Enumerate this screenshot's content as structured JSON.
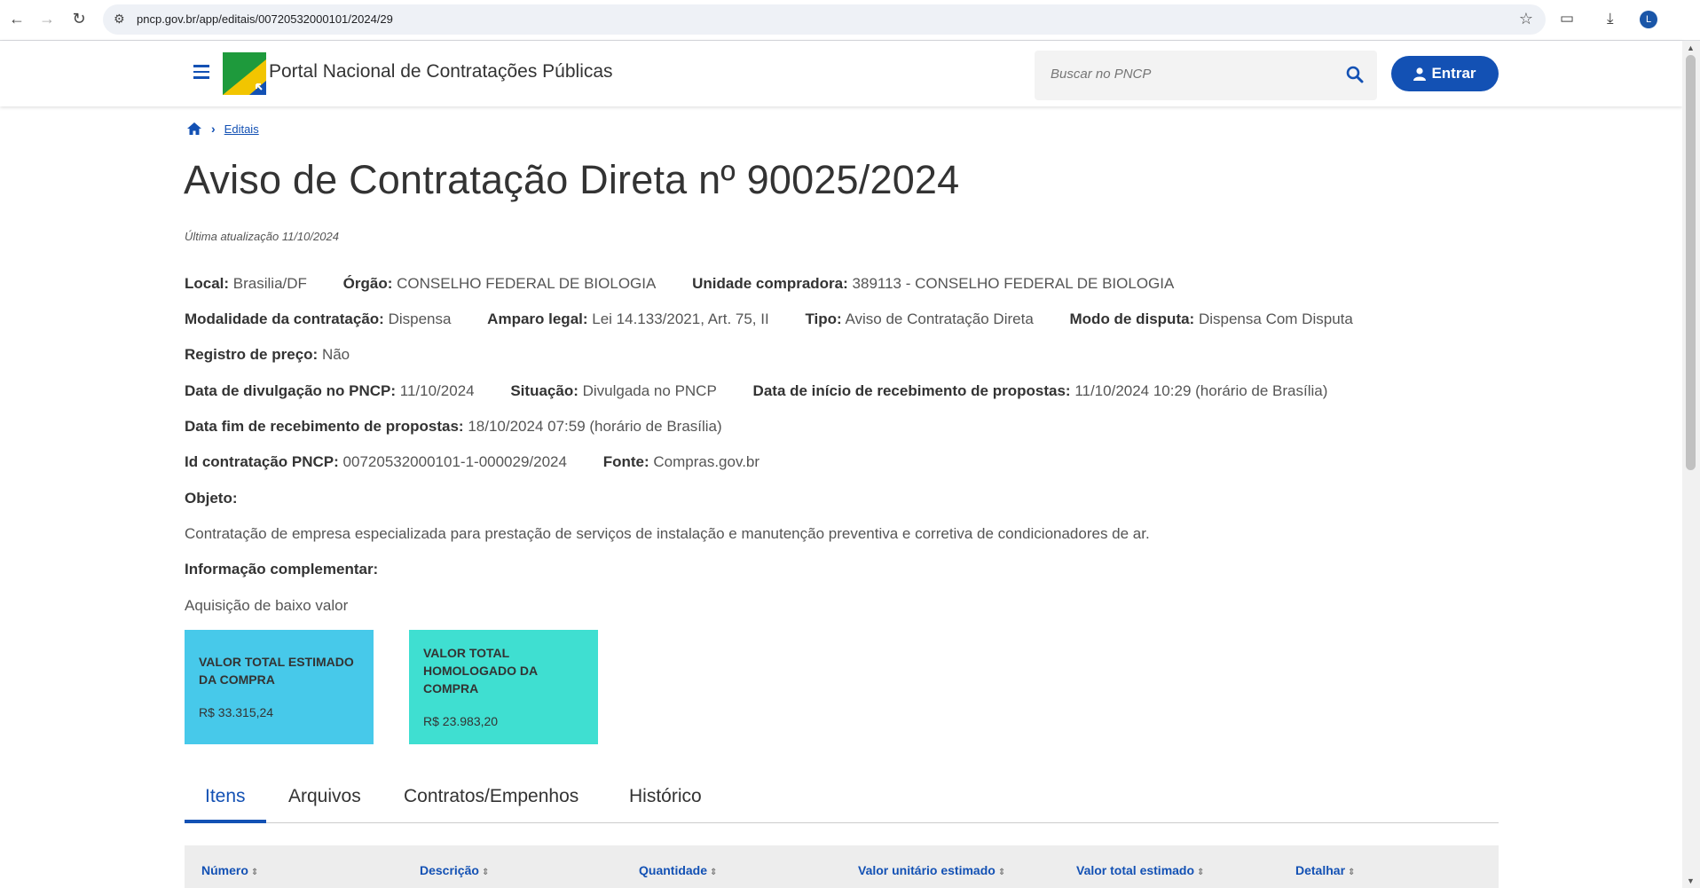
{
  "browser": {
    "url": "pncp.gov.br/app/editais/00720532000101/2024/29",
    "profile_initial": "L"
  },
  "header": {
    "site_title": "Portal Nacional de Contratações Públicas",
    "search_placeholder": "Buscar no PNCP",
    "login_label": "Entrar"
  },
  "breadcrumb": {
    "link": "Editais"
  },
  "page": {
    "title": "Aviso de Contratação Direta nº 90025/2024",
    "updated": "Última atualização 11/10/2024"
  },
  "details": {
    "local_label": "Local:",
    "local_value": "Brasilia/DF",
    "orgao_label": "Órgão:",
    "orgao_value": "CONSELHO FEDERAL DE BIOLOGIA",
    "unidade_label": "Unidade compradora:",
    "unidade_value": "389113 - CONSELHO FEDERAL DE BIOLOGIA",
    "modalidade_label": "Modalidade da contratação:",
    "modalidade_value": "Dispensa",
    "amparo_label": "Amparo legal:",
    "amparo_value": "Lei 14.133/2021, Art. 75, II",
    "tipo_label": "Tipo:",
    "tipo_value": "Aviso de Contratação Direta",
    "modo_label": "Modo de disputa:",
    "modo_value": "Dispensa Com Disputa",
    "registro_label": "Registro de preço:",
    "registro_value": "Não",
    "divulgacao_label": "Data de divulgação no PNCP:",
    "divulgacao_value": "11/10/2024",
    "situacao_label": "Situação:",
    "situacao_value": "Divulgada no PNCP",
    "inicio_label": "Data de início de recebimento de propostas:",
    "inicio_value": "11/10/2024 10:29 (horário de Brasília)",
    "fim_label": "Data fim de recebimento de propostas:",
    "fim_value": "18/10/2024 07:59 (horário de Brasília)",
    "id_label": "Id contratação PNCP:",
    "id_value": "00720532000101-1-000029/2024",
    "fonte_label": "Fonte:",
    "fonte_value": "Compras.gov.br",
    "objeto_label": "Objeto:",
    "objeto_value": "Contratação de empresa especializada para prestação de serviços de instalação e manutenção preventiva e corretiva de condicionadores de ar.",
    "info_label": "Informação complementar:",
    "info_value": "Aquisição de baixo valor"
  },
  "cards": [
    {
      "title": "VALOR TOTAL ESTIMADO DA COMPRA",
      "value": "R$ 33.315,24",
      "color": "#47c9ea"
    },
    {
      "title": "VALOR TOTAL HOMOLOGADO DA COMPRA",
      "value": "R$ 23.983,20",
      "color": "#3fdfd1"
    }
  ],
  "tabs": [
    "Itens",
    "Arquivos",
    "Contratos/Empenhos",
    "Histórico"
  ],
  "table": {
    "headers": [
      "Número",
      "Descrição",
      "Quantidade",
      "Valor unitário estimado",
      "Valor total estimado",
      "Detalhar"
    ]
  },
  "colors": {
    "primary": "#1351b4"
  }
}
